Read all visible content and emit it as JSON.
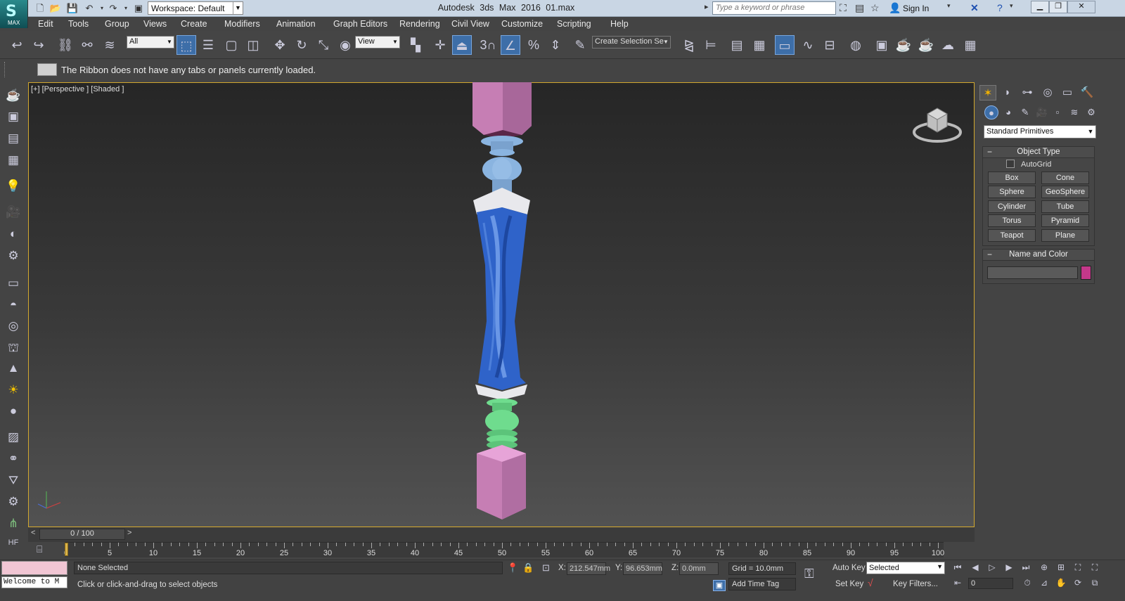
{
  "app": {
    "title": "Autodesk 3ds Max 2016",
    "file": "01.max",
    "logo_text": "MAX",
    "workspace": "Workspace: Default",
    "search_placeholder": "Type a keyword or phrase",
    "sign_in": "Sign In"
  },
  "menu": [
    "Edit",
    "Tools",
    "Group",
    "Views",
    "Create",
    "Modifiers",
    "Animation",
    "Graph Editors",
    "Rendering",
    "Civil View",
    "Customize",
    "Scripting",
    "Help"
  ],
  "toolbar": {
    "selection_filter": "All",
    "ref_coord": "View",
    "snap_3": "3",
    "named_selection": "Create Selection Se"
  },
  "ribbon": {
    "message": "The Ribbon does not have any tabs or panels currently loaded."
  },
  "viewport": {
    "label": "[+] [Perspective ] [Shaded ]",
    "colors": {
      "pink": "#c67eb4",
      "lightblue": "#8ab4e0",
      "white": "#e8e8ec",
      "blue": "#2f63c9",
      "green": "#6fdc8e",
      "border": "#d2a82e"
    }
  },
  "timeslider": {
    "position": "0 / 100",
    "left_arrow": "<",
    "right_arrow": ">"
  },
  "trackbar": {
    "ticks": [
      "0",
      "5",
      "10",
      "15",
      "20",
      "25",
      "30",
      "35",
      "40",
      "45",
      "50",
      "55",
      "60",
      "65",
      "70",
      "75",
      "80",
      "85",
      "90",
      "95",
      "100"
    ]
  },
  "status": {
    "welcome": "Welcome to M",
    "selection": "None Selected",
    "prompt": "Click or click-and-drag to select objects",
    "x_label": "X:",
    "x_value": "212.547mm",
    "y_label": "Y:",
    "y_value": "96.653mm",
    "z_label": "Z:",
    "z_value": "0.0mm",
    "grid": "Grid = 10.0mm",
    "add_time_tag": "Add Time Tag",
    "auto_key": "Auto Key",
    "set_key": "Set Key",
    "key_mode": "Selected",
    "key_filters": "Key Filters...",
    "frame": "0"
  },
  "command_panel": {
    "category": "Standard Primitives",
    "object_type": {
      "title": "Object Type",
      "autogrid": "AutoGrid",
      "buttons": [
        "Box",
        "Cone",
        "Sphere",
        "GeoSphere",
        "Cylinder",
        "Tube",
        "Torus",
        "Pyramid",
        "Teapot",
        "Plane"
      ]
    },
    "name_and_color": {
      "title": "Name and Color",
      "name": "",
      "color": "#c4388a"
    }
  }
}
